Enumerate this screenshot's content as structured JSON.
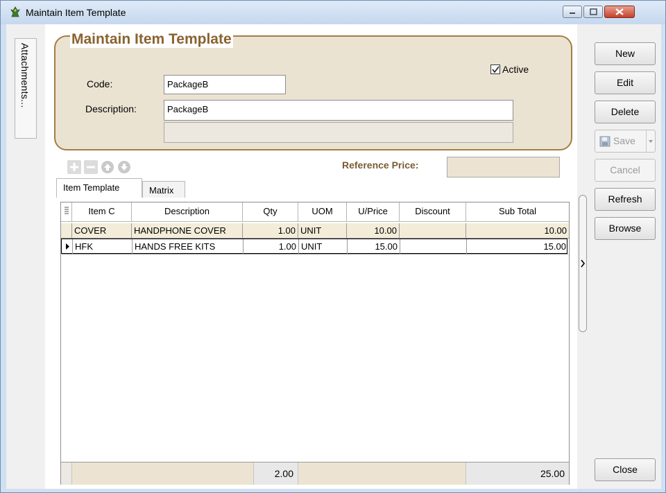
{
  "window": {
    "title": "Maintain Item Template",
    "controls": [
      "minimize",
      "maximize",
      "close"
    ]
  },
  "sidebar": {
    "attachments_label": "Attachments..."
  },
  "header_group": {
    "title": "Maintain Item Template",
    "code_label": "Code:",
    "code_value": "PackageB",
    "description_label": "Description:",
    "description_value": "PackageB",
    "description2_value": "",
    "active_label": "Active",
    "active_checked": true
  },
  "toolbar": {
    "icons": [
      "plus-icon",
      "minus-icon",
      "arrow-up-icon",
      "arrow-down-icon"
    ],
    "reference_price_label": "Reference Price:",
    "reference_price_value": ""
  },
  "tabs": [
    {
      "label": "Item Template",
      "selected": true
    },
    {
      "label": "Matrix",
      "selected": false
    }
  ],
  "grid": {
    "columns": [
      "Item C",
      "Description",
      "Qty",
      "UOM",
      "U/Price",
      "Discount",
      "Sub Total"
    ],
    "rows": [
      {
        "item_code": "COVER",
        "description": "HANDPHONE COVER",
        "qty": "1.00",
        "uom": "UNIT",
        "unit_price": "10.00",
        "discount": "",
        "sub_total": "10.00"
      },
      {
        "item_code": "HFK",
        "description": "HANDS FREE KITS",
        "qty": "1.00",
        "uom": "UNIT",
        "unit_price": "15.00",
        "discount": "",
        "sub_total": "15.00"
      }
    ],
    "footer": {
      "qty_total": "2.00",
      "sub_total_total": "25.00"
    }
  },
  "buttons": {
    "new": "New",
    "edit": "Edit",
    "delete": "Delete",
    "save": "Save",
    "cancel": "Cancel",
    "refresh": "Refresh",
    "browse": "Browse",
    "close": "Close"
  },
  "colors": {
    "group_fill": "#ebe3d2",
    "group_border": "#a37d45",
    "group_title": "#8a6230",
    "selected_row": "#f3ecd9"
  }
}
